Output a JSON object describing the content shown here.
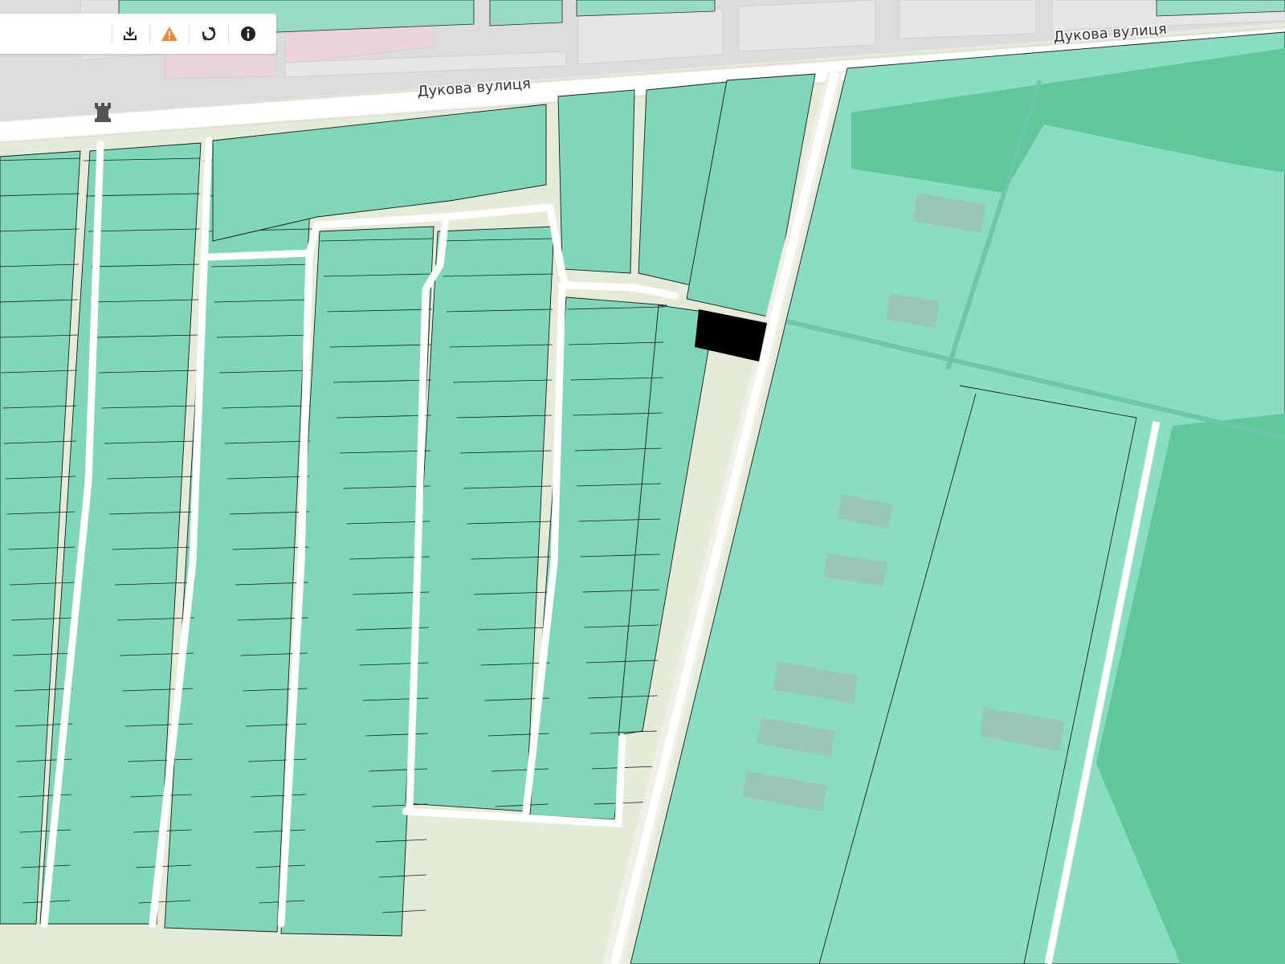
{
  "map": {
    "streets": [
      {
        "name": "Дукова вулиця"
      },
      {
        "name": "Дукова вулиця"
      }
    ],
    "colors": {
      "background": "#e4ecd8",
      "parcel_fill": "#7fd6b8",
      "parcel_border": "#1a1a1a",
      "residential_gray": "#dcdcdc",
      "road": "#ffffff",
      "forest": "#5fc79a",
      "building": "#a8b4ad",
      "highlighted_parcel": "#000000",
      "parcel_blue": "#82bccb",
      "parcel_pink": "#ead3dc"
    },
    "map_marker": {
      "icon": "historic-monument-icon"
    }
  },
  "toolbar": {
    "search": {
      "value": ""
    },
    "buttons": [
      {
        "id": "download",
        "icon": "download-icon",
        "color": "#222222"
      },
      {
        "id": "warning",
        "icon": "warning-icon",
        "color": "#f0883a"
      },
      {
        "id": "refresh",
        "icon": "refresh-icon",
        "color": "#222222"
      },
      {
        "id": "info",
        "icon": "info-icon",
        "color": "#222222"
      }
    ]
  }
}
